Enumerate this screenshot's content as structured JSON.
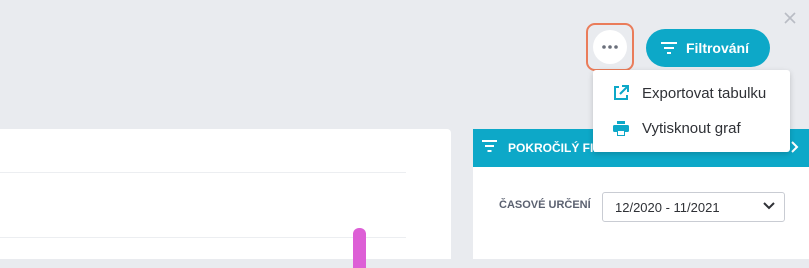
{
  "header": {
    "filter_button_label": "Filtrování"
  },
  "menu": {
    "items": [
      {
        "label": "Exportovat tabulku",
        "icon": "external-link-icon"
      },
      {
        "label": "Vytisknout graf",
        "icon": "printer-icon"
      }
    ]
  },
  "filter_panel": {
    "title": "POKROČILÝ FILT",
    "time_label": "ČASOVÉ URČENÍ",
    "time_select_value": "12/2020 - 11/2021"
  },
  "colors": {
    "accent": "#0da8c8",
    "highlight_border": "#ea7c5a",
    "bar": "#dd5fd6",
    "background": "#e9ebef"
  }
}
